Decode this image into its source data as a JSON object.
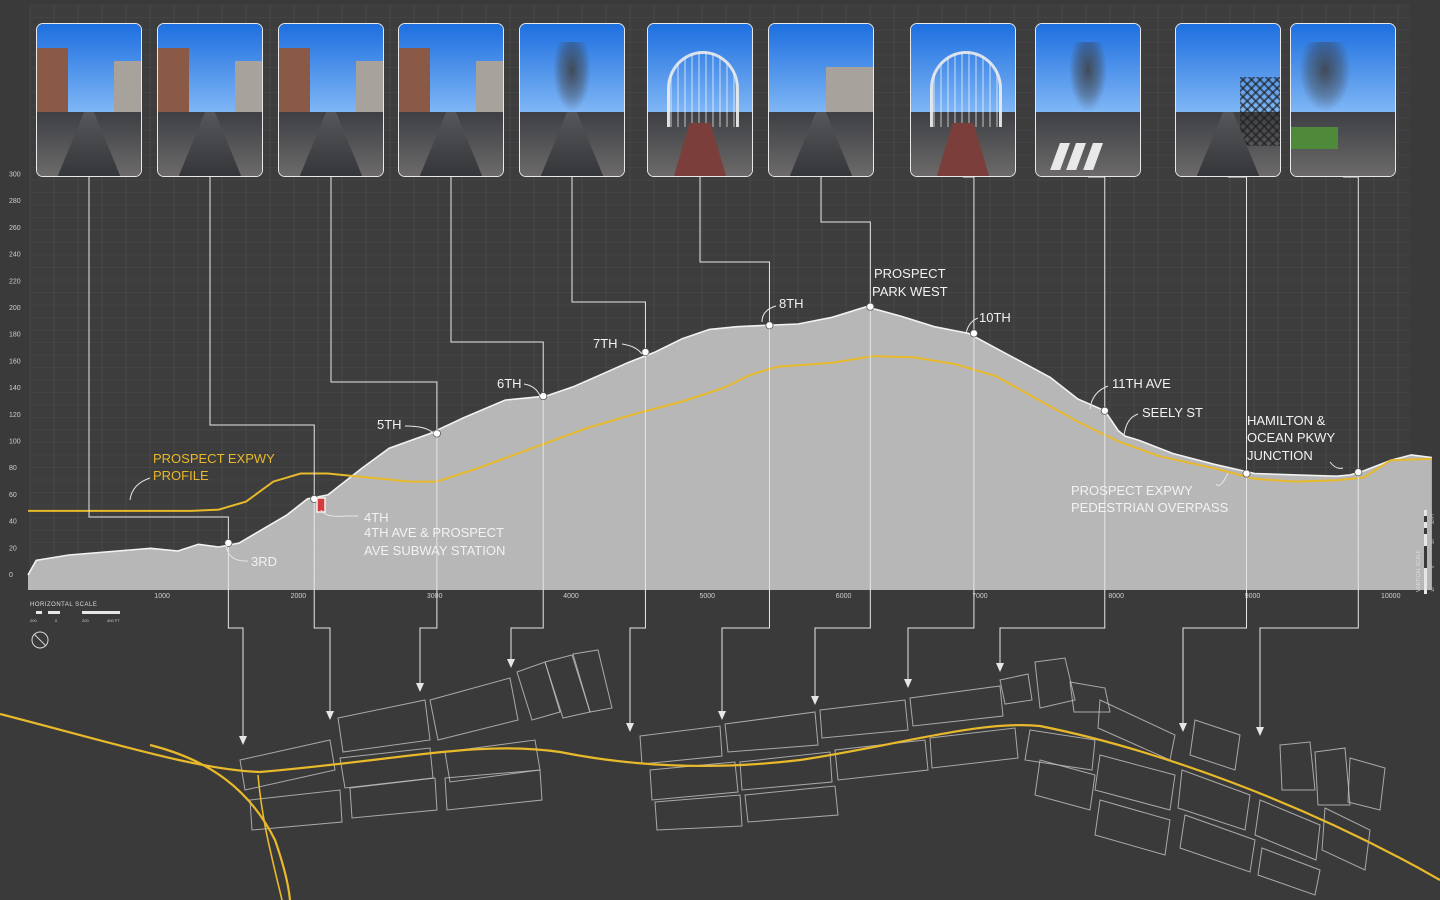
{
  "chart_data": {
    "type": "area",
    "y_ticks": [
      "300",
      "280",
      "260",
      "240",
      "220",
      "200",
      "180",
      "160",
      "140",
      "120",
      "100",
      "80",
      "60",
      "40",
      "20",
      "0"
    ],
    "x_ticks": [
      "1000",
      "2000",
      "3000",
      "4000",
      "5000",
      "6000",
      "7000",
      "8000",
      "9000",
      "10000"
    ],
    "ylim": [
      0,
      300
    ],
    "xlim": [
      0,
      10300
    ],
    "grid": true,
    "series": [
      {
        "color": "#f0f0f0",
        "fill": "#bdbdbd",
        "x": [
          0,
          60,
          300,
          900,
          1100,
          1250,
          1400,
          1550,
          1700,
          1900,
          2050,
          2200,
          2450,
          2650,
          2950,
          3200,
          3500,
          3800,
          4000,
          4200,
          4400,
          4600,
          4800,
          5000,
          5200,
          5400,
          5650,
          5900,
          6150,
          6400,
          6650,
          6900,
          7100,
          7300,
          7500,
          7700,
          7900,
          8000,
          8050,
          8150,
          8400,
          8700,
          9000,
          9300,
          9600,
          9700,
          9800,
          10000,
          10150,
          10300
        ],
        "y": [
          0,
          11,
          15,
          20,
          18,
          23,
          21,
          24,
          33,
          45,
          57,
          60,
          80,
          95,
          106,
          118,
          131,
          134,
          141,
          150,
          159,
          167,
          177,
          184,
          186,
          187,
          188,
          193,
          201,
          194,
          186,
          181,
          170,
          159,
          148,
          132,
          123,
          108,
          104,
          101,
          91,
          83,
          76,
          75,
          74,
          75,
          78,
          86,
          90,
          88
        ]
      },
      {
        "name": "PROSPECT EXPWY PROFILE",
        "color": "#e8b92a",
        "x": [
          0,
          1000,
          1200,
          1400,
          1600,
          1800,
          2000,
          2200,
          2400,
          2600,
          2800,
          3000,
          3300,
          3700,
          4100,
          4500,
          4800,
          5100,
          5300,
          5500,
          5900,
          6200,
          6500,
          6800,
          7100,
          7400,
          7700,
          8000,
          8300,
          8700,
          9000,
          9300,
          9600,
          9800,
          10000,
          10300
        ],
        "y": [
          48,
          48,
          48,
          49,
          55,
          70,
          76,
          76,
          74,
          72,
          70,
          70,
          80,
          95,
          110,
          122,
          130,
          140,
          150,
          156,
          159,
          164,
          163,
          158,
          149,
          132,
          115,
          100,
          89,
          80,
          72,
          70,
          71,
          73,
          86,
          87
        ]
      }
    ],
    "points": [
      {
        "label": "3RD",
        "x": 1470,
        "y": 24
      },
      {
        "label": "4TH",
        "x": 2100,
        "y": 57
      },
      {
        "label": "5TH",
        "x": 3000,
        "y": 106
      },
      {
        "label": "6TH",
        "x": 3780,
        "y": 134
      },
      {
        "label": "7TH",
        "x": 4530,
        "y": 167
      },
      {
        "label": "8TH",
        "x": 5440,
        "y": 187
      },
      {
        "label": "PROSPECT PARK WEST",
        "x": 6180,
        "y": 201
      },
      {
        "label": "10TH",
        "x": 6940,
        "y": 181
      },
      {
        "label": "11TH AVE",
        "x": 7900,
        "y": 123
      },
      {
        "label": "PROSPECT EXPWY PEDESTRIAN OVERPASS",
        "x": 8940,
        "y": 76
      },
      {
        "label": "HAMILTON & OCEAN PKWY JUNCTION",
        "x": 9760,
        "y": 77
      }
    ]
  },
  "labels": {
    "expwy_profile": [
      "PROSPECT EXPWY",
      "PROFILE"
    ],
    "third": "3RD",
    "fourth": "4TH",
    "subway": [
      "4TH AVE & PROSPECT",
      "AVE SUBWAY STATION"
    ],
    "fifth": "5TH",
    "sixth": "6TH",
    "seventh": "7TH",
    "eighth": "8TH",
    "ppw": [
      "PROSPECT",
      "PARK WEST"
    ],
    "tenth": "10TH",
    "eleventh": "11TH AVE",
    "seely": "SEELY ST",
    "overpass": [
      "PROSPECT EXPWY",
      "PEDESTRIAN OVERPASS"
    ],
    "hamilton": [
      "HAMILTON &",
      "OCEAN PKWY",
      "JUNCTION"
    ]
  },
  "scale": {
    "horizontal_title": "HORIZONTAL SCALE",
    "horizontal_ticks": [
      "200",
      "0",
      "200",
      "400 FT"
    ],
    "vertical_title": "VERTICAL SCALE",
    "vertical_ticks": [
      "10",
      "0",
      "20",
      "40 FT"
    ]
  },
  "colors": {
    "background": "#3a3a3b",
    "grid": "#4d4d4e",
    "terrain_fill": "#c1c1c1",
    "terrain_line": "#f2f2f2",
    "expwy": "#e8b92a",
    "leader": "#e6e6e6",
    "subway_marker": "#d63a3a",
    "map_block": "#bdbdbd"
  },
  "photos": [
    {
      "name": "photo-3rd-ave",
      "kind": "street"
    },
    {
      "name": "photo-4th-ave",
      "kind": "street"
    },
    {
      "name": "photo-5th-ave",
      "kind": "street"
    },
    {
      "name": "photo-6th-ave",
      "kind": "street"
    },
    {
      "name": "photo-7th-ave",
      "kind": "road"
    },
    {
      "name": "photo-8th-ave-overpass",
      "kind": "cage"
    },
    {
      "name": "photo-8th-ave-corner",
      "kind": "corner"
    },
    {
      "name": "photo-ppw-overpass",
      "kind": "cage"
    },
    {
      "name": "photo-11th-ave",
      "kind": "crosswalk"
    },
    {
      "name": "photo-pedestrian-overpass",
      "kind": "fence"
    },
    {
      "name": "photo-hamilton-junction",
      "kind": "park"
    }
  ]
}
